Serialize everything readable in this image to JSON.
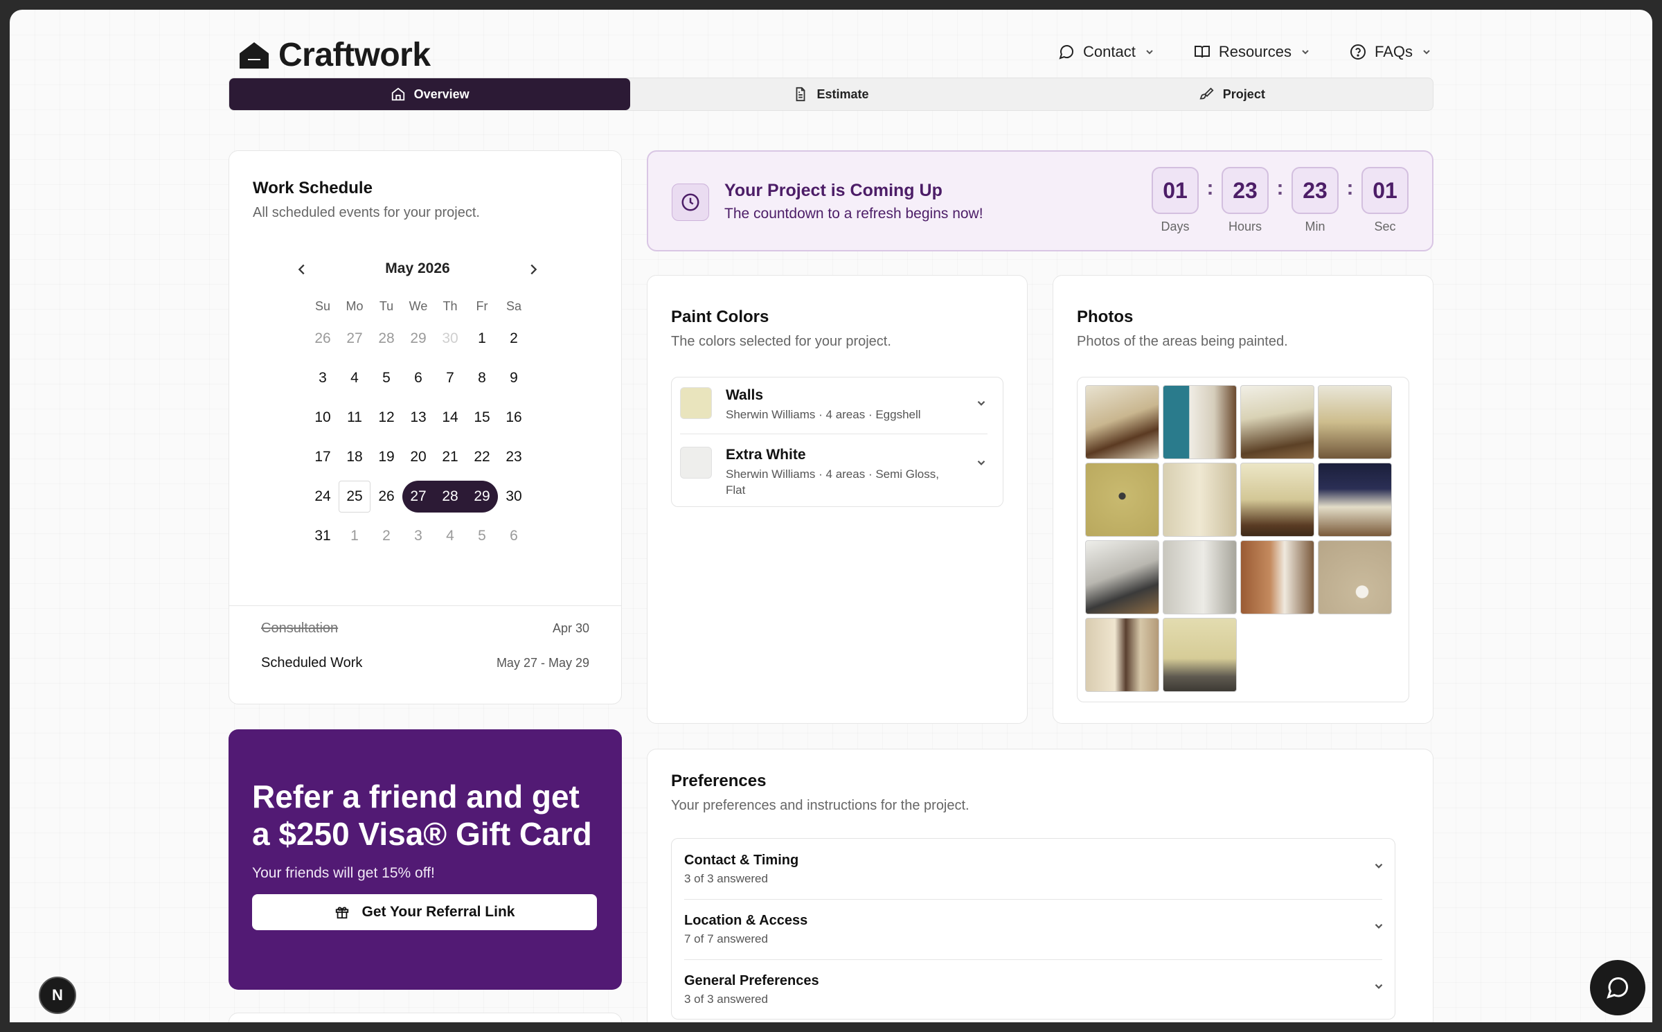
{
  "brand": {
    "name": "Craftwork"
  },
  "nav": [
    {
      "label": "Contact",
      "icon": "message-icon"
    },
    {
      "label": "Resources",
      "icon": "book-icon"
    },
    {
      "label": "FAQs",
      "icon": "help-circle-icon"
    }
  ],
  "tabs": [
    {
      "label": "Overview",
      "icon": "home-icon",
      "active": true
    },
    {
      "label": "Estimate",
      "icon": "document-icon",
      "active": false
    },
    {
      "label": "Project",
      "icon": "paintbrush-icon",
      "active": false
    }
  ],
  "schedule": {
    "title": "Work Schedule",
    "subtitle": "All scheduled events for your project.",
    "month": "May 2026",
    "weekdays": [
      "Su",
      "Mo",
      "Tu",
      "We",
      "Th",
      "Fr",
      "Sa"
    ],
    "weeks": [
      [
        "26",
        "27",
        "28",
        "29",
        "30",
        "1",
        "2"
      ],
      [
        "3",
        "4",
        "5",
        "6",
        "7",
        "8",
        "9"
      ],
      [
        "10",
        "11",
        "12",
        "13",
        "14",
        "15",
        "16"
      ],
      [
        "17",
        "18",
        "19",
        "20",
        "21",
        "22",
        "23"
      ],
      [
        "24",
        "25",
        "26",
        "27",
        "28",
        "29",
        "30"
      ],
      [
        "31",
        "1",
        "2",
        "3",
        "4",
        "5",
        "6"
      ]
    ],
    "today": "25",
    "selected_range": [
      "27",
      "28",
      "29"
    ],
    "events": [
      {
        "name": "Consultation",
        "date": "Apr 30",
        "completed": true
      },
      {
        "name": "Scheduled Work",
        "date": "May 27 - May 29",
        "completed": false
      }
    ]
  },
  "countdown": {
    "title": "Your Project is Coming Up",
    "subtitle": "The countdown to a refresh begins now!",
    "units": [
      {
        "value": "01",
        "label": "Days"
      },
      {
        "value": "23",
        "label": "Hours"
      },
      {
        "value": "23",
        "label": "Min"
      },
      {
        "value": "01",
        "label": "Sec"
      }
    ]
  },
  "paint": {
    "title": "Paint Colors",
    "subtitle": "The colors selected for your project.",
    "items": [
      {
        "name": "Walls",
        "detail": "Sherwin Williams · 4 areas · Eggshell",
        "swatch": "#e9e4bd"
      },
      {
        "name": "Extra White",
        "detail": "Sherwin Williams · 4 areas · Semi Gloss, Flat",
        "swatch": "#eeeeec"
      }
    ]
  },
  "photos": {
    "title": "Photos",
    "subtitle": "Photos of the areas being painted.",
    "count": 14
  },
  "referral": {
    "title": "Refer a friend and get a $250 Visa® Gift Card",
    "subtitle": "Your friends will get 15% off!",
    "button": "Get Your Referral Link"
  },
  "preferences": {
    "title": "Preferences",
    "subtitle": "Your preferences and instructions for the project.",
    "items": [
      {
        "title": "Contact & Timing",
        "status": "3 of 3 answered"
      },
      {
        "title": "Location & Access",
        "status": "7 of 7 answered"
      },
      {
        "title": "General Preferences",
        "status": "3 of 3 answered"
      }
    ]
  },
  "floating": {
    "dev_badge": "N"
  },
  "colors": {
    "accent": "#2c1a35",
    "purple": "#521a74",
    "countdown_bg": "#f6eff9"
  }
}
